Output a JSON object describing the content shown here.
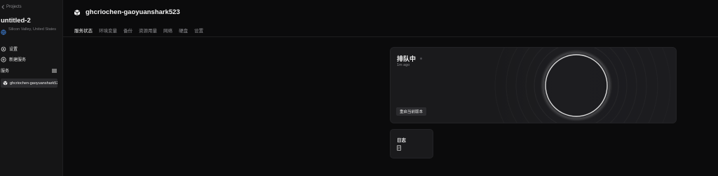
{
  "sidebar": {
    "back_label": "Projects",
    "project_title": "untitled-2",
    "region": "Silicon Valley, United States",
    "settings_label": "设置",
    "new_service_label": "新建服务",
    "services_header": "服务",
    "service_item": "ghcriochen-gaoyuanshark523"
  },
  "header": {
    "service_title": "ghcriochen-gaoyuanshark523",
    "tabs": [
      "服务状态",
      "环境变量",
      "备份",
      "资源用量",
      "网络",
      "硬盘",
      "设置"
    ],
    "active_tab": "服务状态"
  },
  "status": {
    "title": "排队中",
    "time": "1m ago",
    "redeploy_label": "重启当前版本"
  },
  "logs": {
    "title": "日志"
  }
}
